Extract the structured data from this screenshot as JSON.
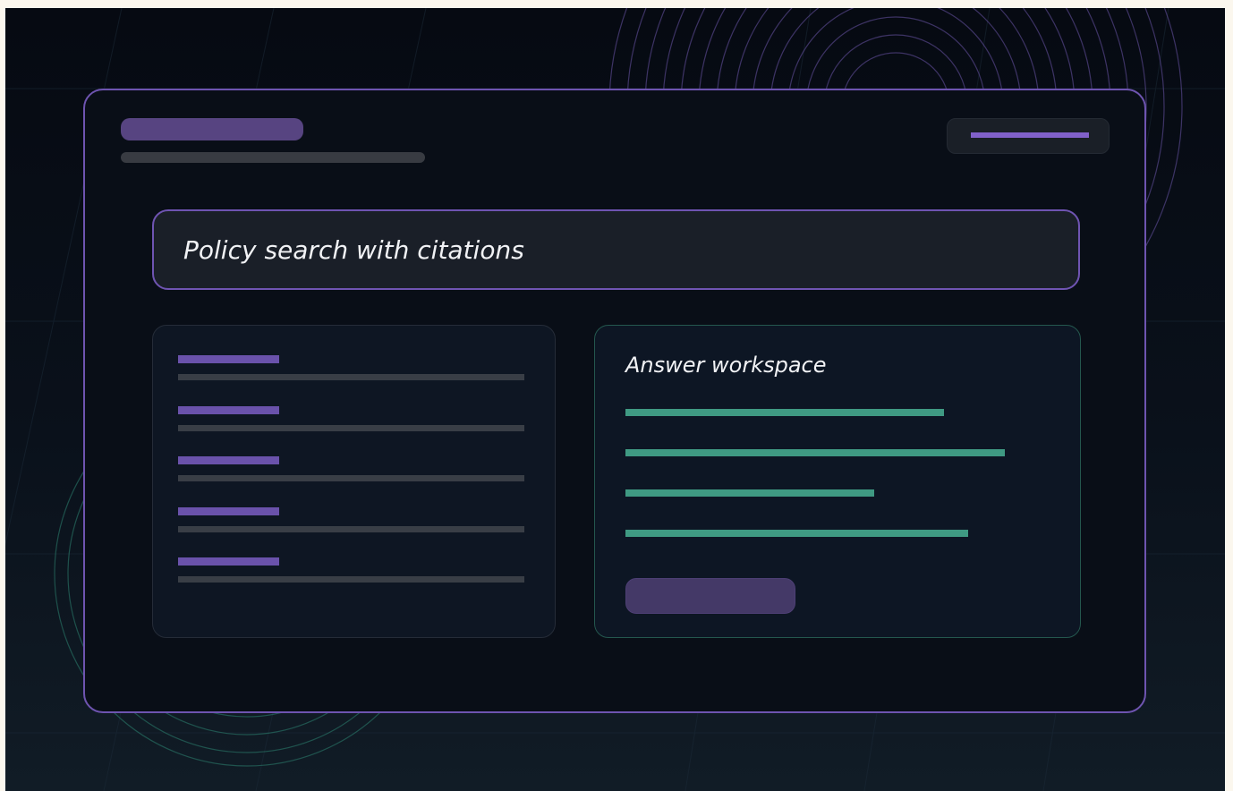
{
  "search": {
    "query": "Policy search with citations"
  },
  "answer": {
    "title": "Answer workspace"
  },
  "results": {
    "count": 5
  },
  "colors": {
    "accent_purple": "#6e54b0",
    "accent_green": "#3f9a83",
    "panel_bg": "#0e1623",
    "background": "#060a12"
  },
  "icons": []
}
